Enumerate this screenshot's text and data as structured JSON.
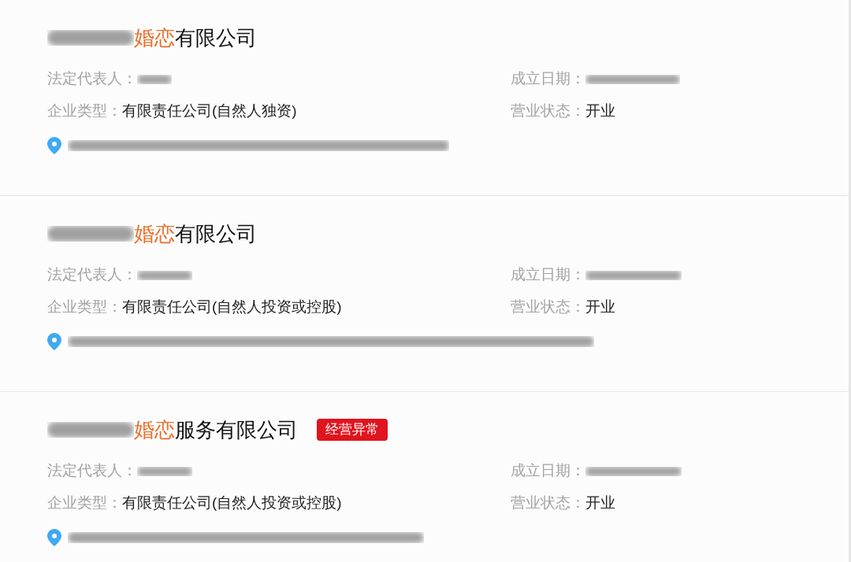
{
  "companies": [
    {
      "title": {
        "redacted_prefix": true,
        "highlight": "婚恋",
        "rest": "有限公司"
      },
      "fields": [
        {
          "label": "法定代表人：",
          "kind": "redacted"
        },
        {
          "label": "成立日期：",
          "kind": "redacted"
        },
        {
          "label": "企业类型：",
          "kind": "text",
          "value": "有限责任公司(自然人独资)"
        },
        {
          "label": "营业状态：",
          "kind": "text",
          "value": "开业"
        }
      ],
      "address": {
        "kind": "redacted"
      }
    },
    {
      "title": {
        "redacted_prefix": true,
        "highlight": "婚恋",
        "rest": "有限公司"
      },
      "fields": [
        {
          "label": "法定代表人：",
          "kind": "redacted"
        },
        {
          "label": "成立日期：",
          "kind": "redacted"
        },
        {
          "label": "企业类型：",
          "kind": "text",
          "value": "有限责任公司(自然人投资或控股)"
        },
        {
          "label": "营业状态：",
          "kind": "text",
          "value": "开业"
        }
      ],
      "address": {
        "kind": "redacted"
      }
    },
    {
      "title": {
        "redacted_prefix": true,
        "highlight": "婚恋",
        "rest": "服务有限公司"
      },
      "badge": "经营异常",
      "fields": [
        {
          "label": "法定代表人：",
          "kind": "redacted"
        },
        {
          "label": "成立日期：",
          "kind": "redacted"
        },
        {
          "label": "企业类型：",
          "kind": "text",
          "value": "有限责任公司(自然人投资或控股)"
        },
        {
          "label": "营业状态：",
          "kind": "text",
          "value": "开业"
        }
      ],
      "address": {
        "kind": "redacted"
      }
    }
  ]
}
